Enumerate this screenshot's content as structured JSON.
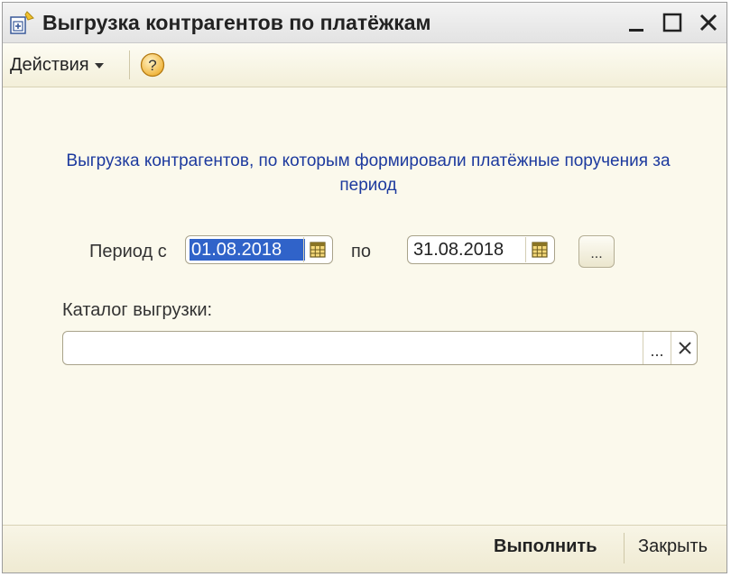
{
  "window": {
    "title": "Выгрузка контрагентов по платёжкам",
    "icon": "document-export-icon"
  },
  "toolbar": {
    "actions_label": "Действия",
    "help_label": "?"
  },
  "form": {
    "description": "Выгрузка контрагентов, по которым формировали платёжные поручения за период",
    "period_from_label": "Период с",
    "period_from_value": "01.08.2018",
    "period_to_label": "по",
    "period_to_value": "31.08.2018",
    "period_select_label": "...",
    "catalog_label": "Каталог выгрузки:",
    "catalog_value": "",
    "catalog_choose_label": "..."
  },
  "footer": {
    "execute_label": "Выполнить",
    "close_label": "Закрыть"
  },
  "colors": {
    "background": "#fbf9ec",
    "description_text": "#1d3a9e",
    "selection": "#3063c9"
  }
}
